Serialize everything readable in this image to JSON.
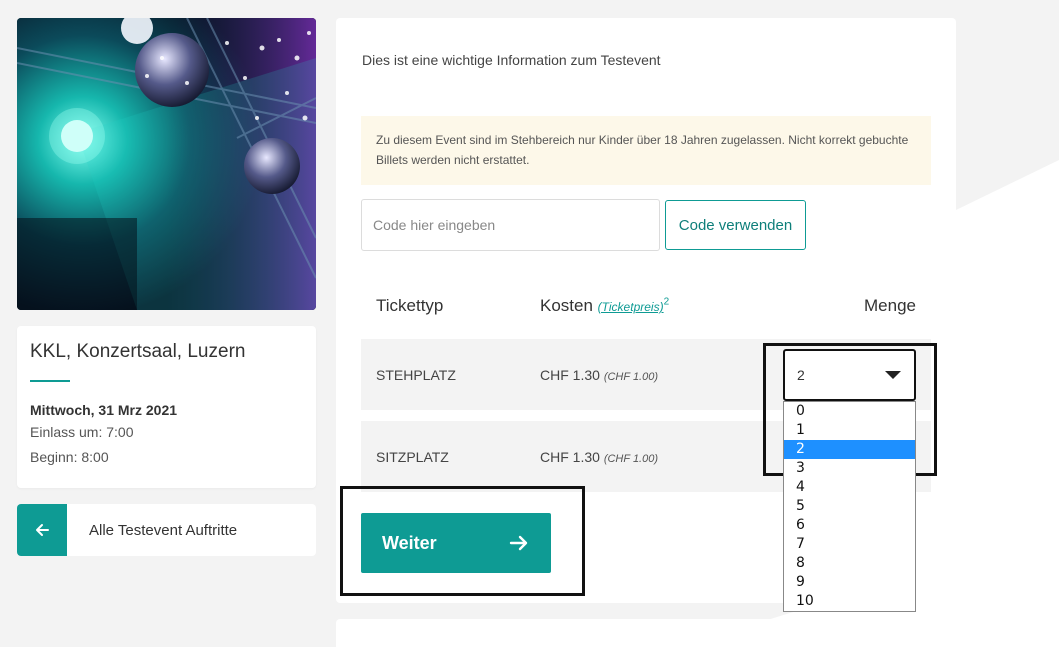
{
  "venue": {
    "name": "KKL, Konzertsaal, Luzern",
    "date": "Mittwoch, 31 Mrz 2021",
    "entry": "Einlass um: 7:00",
    "start": "Beginn: 8:00"
  },
  "back_link": {
    "label": "Alle Testevent Auftritte",
    "icon": "arrow-left-icon"
  },
  "info_text": "Dies ist eine wichtige Information zum Testevent",
  "notice": "Zu diesem Event sind im Stehbereich nur Kinder über 18 Jahren zugelassen. Nicht korrekt gebuchte Billets werden nicht erstattet.",
  "code": {
    "placeholder": "Code hier eingeben",
    "button_label": "Code verwenden"
  },
  "table": {
    "col_type": "Tickettyp",
    "col_cost": "Kosten",
    "col_cost_link": "(Ticketpreis)",
    "col_cost_footnote": "2",
    "col_qty": "Menge",
    "rows": [
      {
        "name": "STEHPLATZ",
        "price": "CHF 1.30",
        "net": "(CHF 1.00)"
      },
      {
        "name": "SITZPLATZ",
        "price": "CHF 1.30",
        "net": "(CHF 1.00)"
      }
    ]
  },
  "quantity_select": {
    "value": "2",
    "options": [
      "0",
      "1",
      "2",
      "3",
      "4",
      "5",
      "6",
      "7",
      "8",
      "9",
      "10"
    ],
    "selected_index": 2
  },
  "weiter_button": {
    "label": "Weiter",
    "icon": "arrow-right-icon"
  },
  "colors": {
    "accent": "#0e9b94",
    "notice_bg": "#fdf8e9",
    "selected_option": "#1e90ff"
  }
}
